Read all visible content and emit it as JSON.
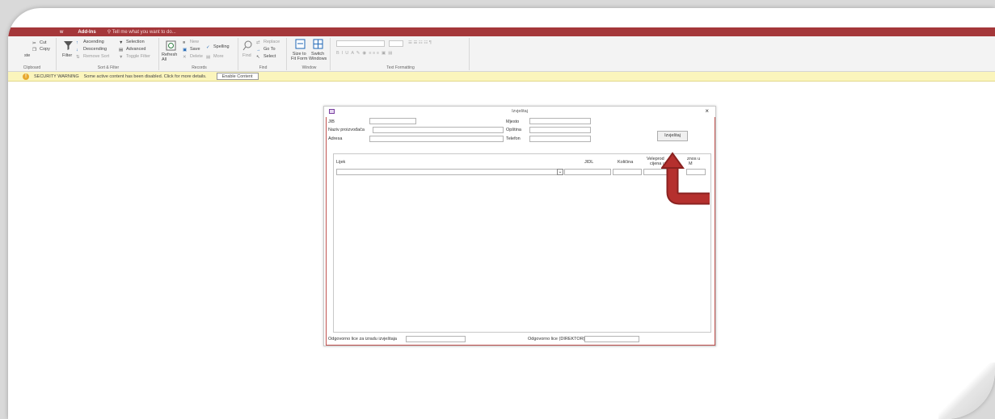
{
  "ribbon": {
    "tabs": [
      "w",
      "Add-Ins"
    ],
    "tell_me": "Tell me what you want to do...",
    "clipboard": {
      "cut": "Cut",
      "copy": "Copy",
      "paste": "ste",
      "label": "Clipboard"
    },
    "sort_filter": {
      "filter": "Filter",
      "ascending": "Ascending",
      "descending": "Descending",
      "remove_sort": "Remove Sort",
      "selection": "Selection",
      "advanced": "Advanced",
      "toggle_filter": "Toggle Filter",
      "label": "Sort & Filter"
    },
    "records": {
      "refresh": "Refresh",
      "refresh2": "All",
      "new": "New",
      "save": "Save",
      "delete": "Delete",
      "spelling": "Spelling",
      "more": "More",
      "label": "Records"
    },
    "find": {
      "find": "Find",
      "replace": "Replace",
      "goto": "Go To",
      "select": "Select",
      "label": "Find"
    },
    "window": {
      "size_to_fit": "Size to",
      "size_to_fit2": "Fit Form",
      "switch": "Switch",
      "switch2": "Windows",
      "label": "Window"
    },
    "text_formatting": {
      "label": "Text Formatting"
    }
  },
  "security": {
    "title": "SECURITY WARNING",
    "message": "Some active content has been disabled. Click for more details.",
    "button": "Enable Content"
  },
  "form": {
    "title": "Izvještaj",
    "labels": {
      "jib": "JIB",
      "naziv": "Naziv proizvođača",
      "adresa": "Adresa",
      "mjesto": "Mjesto",
      "opstina": "Opština",
      "telefon": "Telefon"
    },
    "button": "Izvještaj",
    "subform": {
      "columns": [
        "Lijek",
        "JIDL",
        "Količina",
        "Veleprodajna cijena u KM",
        "Iznos u KM"
      ],
      "visible_headers": {
        "lijek": "Lijek",
        "jidl": "JIDL",
        "kolicina": "Količina",
        "vele1": "Veleprod",
        "vele2": "cijena u",
        "iznos1": "znos u",
        "iznos2": "M"
      }
    },
    "footer": {
      "odgovorno_izrada": "Odgovorno lice za izradu izvještaja",
      "odgovorno_direktor": "Odgovorno lice (DIREKTOR)"
    }
  },
  "colors": {
    "accent": "#a4373a",
    "warning_bar": "#fbf5bc",
    "arrow": "#b5302e"
  }
}
